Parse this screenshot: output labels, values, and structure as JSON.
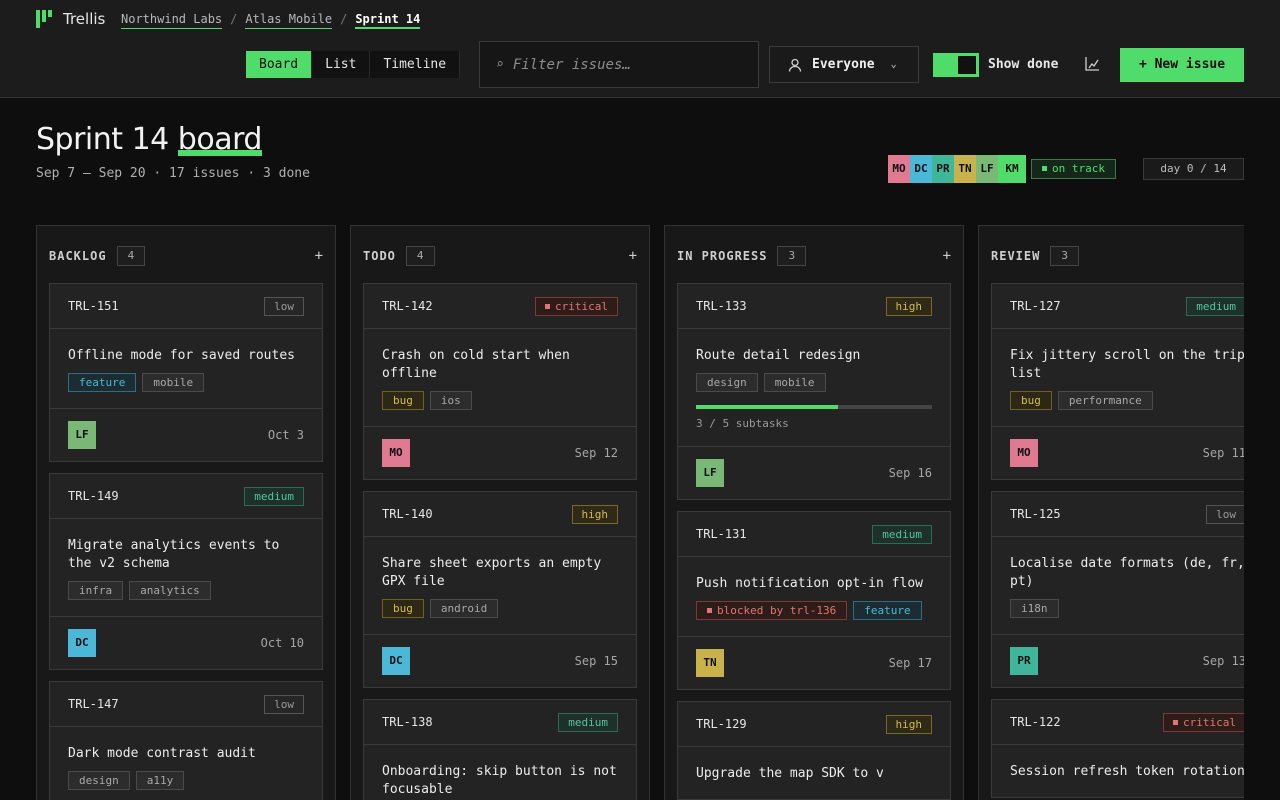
{
  "app": {
    "name": "Trellis"
  },
  "breadcrumbs": [
    {
      "label": "Northwind Labs"
    },
    {
      "label": "Atlas Mobile"
    },
    {
      "label": "Sprint 14"
    }
  ],
  "views": [
    {
      "label": "Board",
      "active": true
    },
    {
      "label": "List",
      "active": false
    },
    {
      "label": "Timeline",
      "active": false
    }
  ],
  "filter": {
    "placeholder": "Filter issues…",
    "value": ""
  },
  "assignee_filter": {
    "label": "Everyone"
  },
  "show_done": {
    "label": "Show done",
    "on": true
  },
  "new_issue": {
    "label": "+ New issue"
  },
  "page": {
    "title_main": "Sprint 14",
    "title_highlight": "board",
    "subtitle": "Sep 7 – Sep 20 · 17 issues · 3 done",
    "status": "on track",
    "day": "day 0 / 14"
  },
  "team": [
    {
      "initials": "MO",
      "color": "#e07a92"
    },
    {
      "initials": "DC",
      "color": "#4bb8d8"
    },
    {
      "initials": "PR",
      "color": "#3fb59a"
    },
    {
      "initials": "TN",
      "color": "#c9b24c"
    },
    {
      "initials": "LF",
      "color": "#7ab876"
    },
    {
      "initials": "KM",
      "color": "#4fdc6a"
    }
  ],
  "colors": {
    "accent": "#4fdc6a",
    "MO": "#e07a92",
    "DC": "#4bb8d8",
    "PR": "#3fb59a",
    "TN": "#c9b24c",
    "LF": "#7ab876"
  },
  "columns": [
    {
      "name": "BACKLOG",
      "count": "4",
      "cards": [
        {
          "id": "TRL-151",
          "priority": "low",
          "title": "Offline mode for saved routes",
          "tags": [
            {
              "label": "feature",
              "kind": "feature"
            },
            {
              "label": "mobile",
              "kind": ""
            }
          ],
          "assignee": "LF",
          "due": "Oct 3"
        },
        {
          "id": "TRL-149",
          "priority": "medium",
          "title": "Migrate analytics events to the v2 schema",
          "tags": [
            {
              "label": "infra",
              "kind": ""
            },
            {
              "label": "analytics",
              "kind": ""
            }
          ],
          "assignee": "DC",
          "due": "Oct 10"
        },
        {
          "id": "TRL-147",
          "priority": "low",
          "title": "Dark mode contrast audit",
          "tags": [
            {
              "label": "design",
              "kind": ""
            },
            {
              "label": "a11y",
              "kind": ""
            }
          ],
          "assignee": "",
          "due": ""
        }
      ]
    },
    {
      "name": "TODO",
      "count": "4",
      "cards": [
        {
          "id": "TRL-142",
          "priority": "critical",
          "title": "Crash on cold start when offline",
          "tags": [
            {
              "label": "bug",
              "kind": "bug"
            },
            {
              "label": "ios",
              "kind": ""
            }
          ],
          "assignee": "MO",
          "due": "Sep 12"
        },
        {
          "id": "TRL-140",
          "priority": "high",
          "title": "Share sheet exports an empty GPX file",
          "tags": [
            {
              "label": "bug",
              "kind": "bug"
            },
            {
              "label": "android",
              "kind": ""
            }
          ],
          "assignee": "DC",
          "due": "Sep 15"
        },
        {
          "id": "TRL-138",
          "priority": "medium",
          "title": "Onboarding: skip button is not focusable",
          "tags": [],
          "assignee": "",
          "due": ""
        }
      ]
    },
    {
      "name": "IN PROGRESS",
      "count": "3",
      "cards": [
        {
          "id": "TRL-133",
          "priority": "high",
          "title": "Route detail redesign",
          "tags": [
            {
              "label": "design",
              "kind": ""
            },
            {
              "label": "mobile",
              "kind": ""
            }
          ],
          "progress": 0.6,
          "progress_text": "3 / 5 subtasks",
          "assignee": "LF",
          "due": "Sep 16"
        },
        {
          "id": "TRL-131",
          "priority": "medium",
          "title": "Push notification opt-in flow",
          "tags": [
            {
              "label": "blocked by trl-136",
              "kind": "blocked"
            },
            {
              "label": "feature",
              "kind": "feature"
            }
          ],
          "assignee": "TN",
          "due": "Sep 17"
        },
        {
          "id": "TRL-129",
          "priority": "high",
          "title": "Upgrade the map SDK to v",
          "tags": [],
          "assignee": "",
          "due": ""
        }
      ]
    },
    {
      "name": "REVIEW",
      "count": "3",
      "cards": [
        {
          "id": "TRL-127",
          "priority": "medium",
          "title": "Fix jittery scroll on the trip list",
          "tags": [
            {
              "label": "bug",
              "kind": "bug"
            },
            {
              "label": "performance",
              "kind": ""
            }
          ],
          "assignee": "MO",
          "due": "Sep 11"
        },
        {
          "id": "TRL-125",
          "priority": "low",
          "title": "Localise date formats (de, fr, pt)",
          "tags": [
            {
              "label": "i18n",
              "kind": ""
            }
          ],
          "assignee": "PR",
          "due": "Sep 13"
        },
        {
          "id": "TRL-122",
          "priority": "critical",
          "title": "Session refresh token rotation",
          "tags": [],
          "assignee": "",
          "due": ""
        }
      ]
    }
  ]
}
